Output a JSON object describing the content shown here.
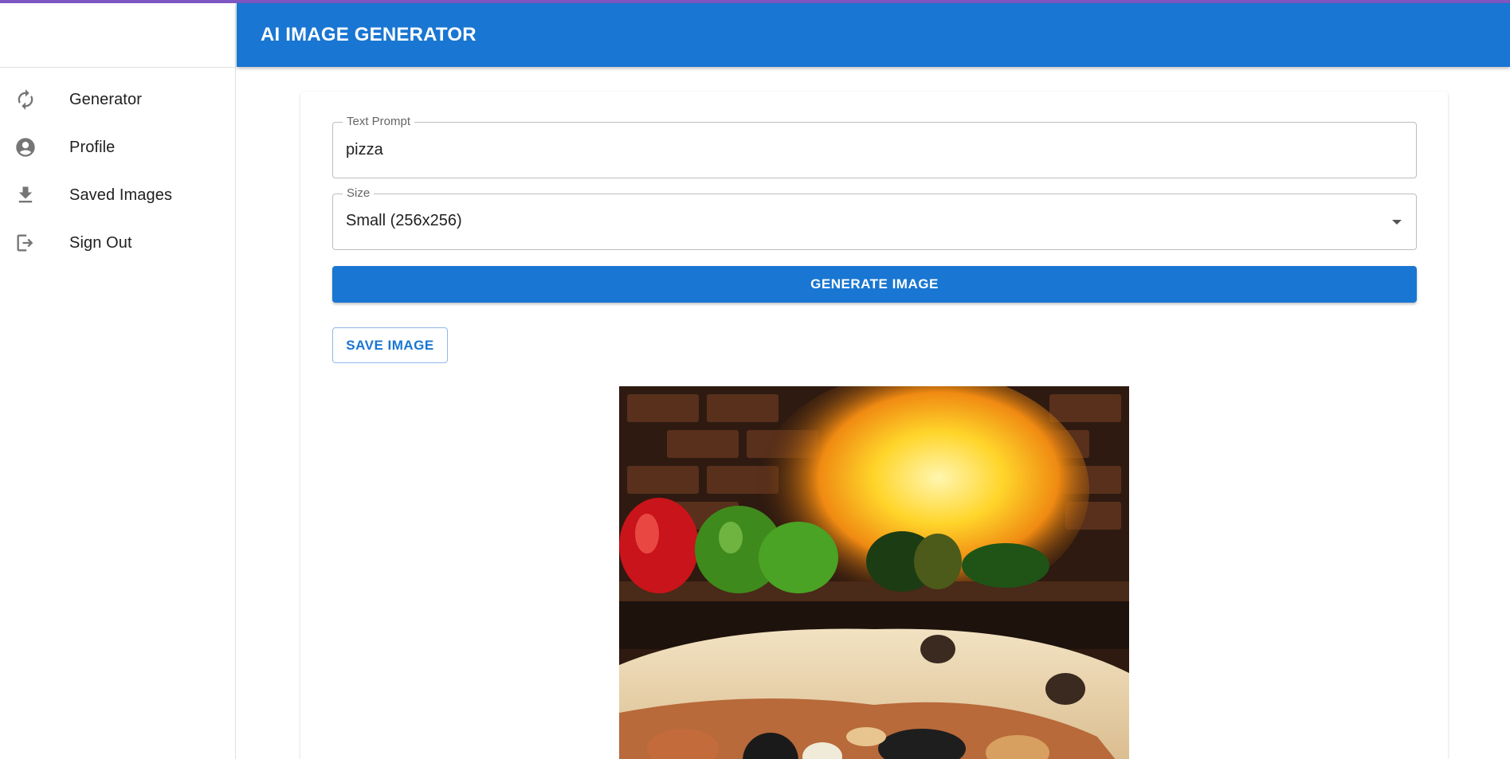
{
  "app": {
    "title": "AI IMAGE GENERATOR",
    "accent_color": "#1976d2",
    "top_strip_color": "#7e57c2"
  },
  "sidebar": {
    "items": [
      {
        "label": "Generator",
        "icon": "refresh-icon"
      },
      {
        "label": "Profile",
        "icon": "account-circle-icon"
      },
      {
        "label": "Saved Images",
        "icon": "download-icon"
      },
      {
        "label": "Sign Out",
        "icon": "logout-icon"
      }
    ]
  },
  "form": {
    "prompt": {
      "label": "Text Prompt",
      "value": "pizza"
    },
    "size": {
      "label": "Size",
      "selected": "Small (256x256)"
    },
    "generate_label": "GENERATE IMAGE",
    "save_label": "SAVE IMAGE"
  },
  "result": {
    "image_subject": "pizza in front of wood-fired oven flames with peppers"
  }
}
